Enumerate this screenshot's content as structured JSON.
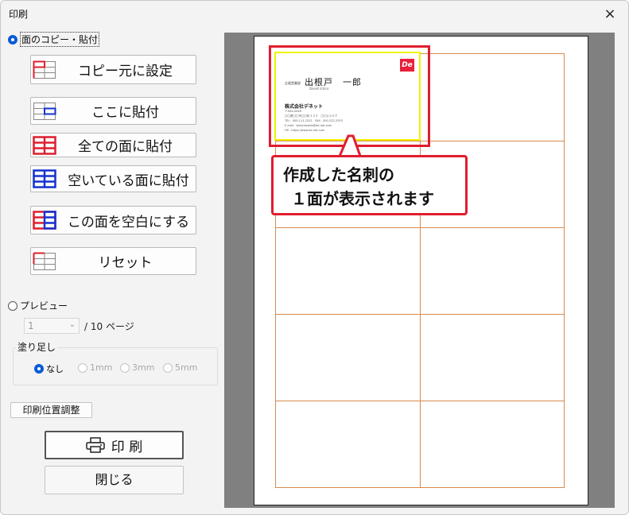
{
  "window": {
    "title": "印刷",
    "close_icon": "×"
  },
  "face_copy": {
    "label": "面のコピー・貼付",
    "selected": true
  },
  "buttons": {
    "copy_source": "コピー元に設定",
    "paste_here": "ここに貼付",
    "paste_all": "全ての面に貼付",
    "paste_empty": "空いている面に貼付",
    "make_blank": "この面を空白にする",
    "reset": "リセット"
  },
  "preview_mode": {
    "label": "プレビュー",
    "selected": false
  },
  "page": {
    "current": "1",
    "total": "/ 10 ページ"
  },
  "bleed": {
    "title": "塗り足し",
    "options": [
      "なし",
      "1mm",
      "3mm",
      "5mm"
    ],
    "selected": "なし"
  },
  "adjust_button": "印刷位置調整",
  "print_button": "印 刷",
  "close_button": "閉じる",
  "card": {
    "logo": "De",
    "department": "企画営業部",
    "name": "出根戸　一郎",
    "roman": "Denet Ichiro",
    "company": "株式会社デネット",
    "lines": [
      "〒XXX-XXXX",
      "〇〇県〇〇市〇〇町１２３　〇〇ビル５Ｆ",
      "TEL：000-111-2222　FAX：000-222-3333",
      "E-mail：taroyamada@de-net.com",
      "HP：https://www.de-net.com"
    ]
  },
  "callout": {
    "line1": "作成した名刺の",
    "line2": "１面が表示されます"
  },
  "colors": {
    "accent": "#0a5bd6",
    "highlight": "#e01e2e",
    "card_border": "#f2f200",
    "grid": "#d98a4c"
  }
}
